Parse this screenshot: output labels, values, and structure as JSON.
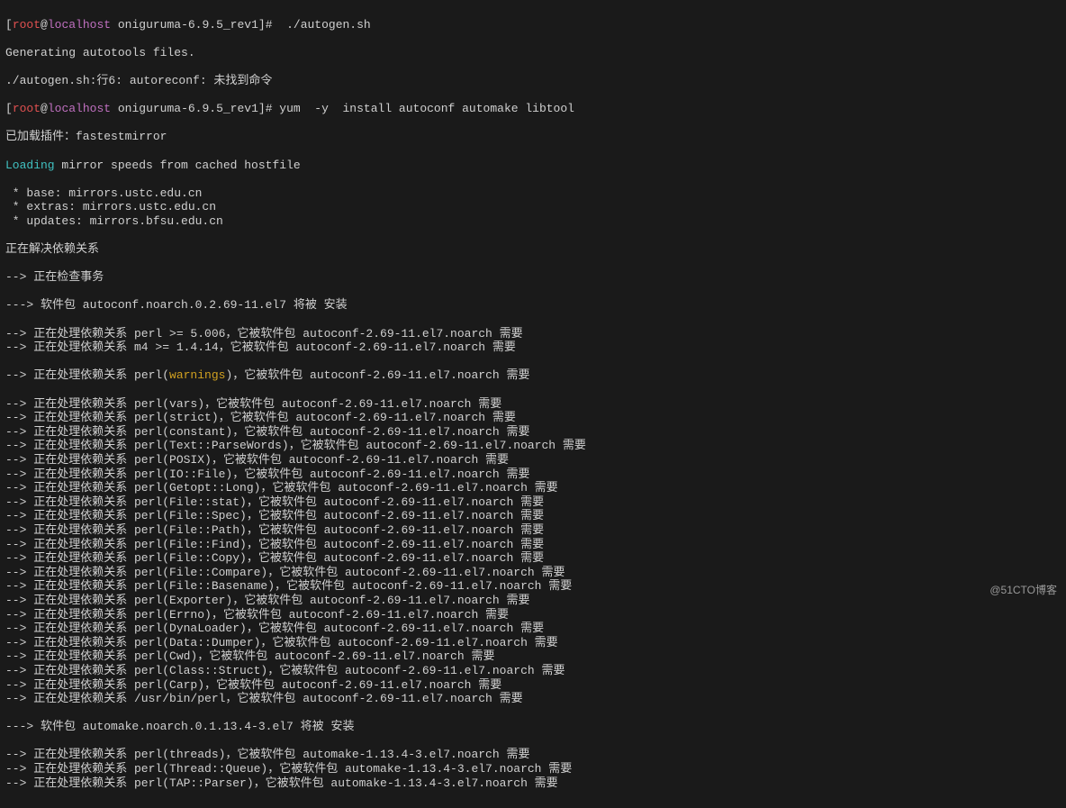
{
  "prompt": {
    "user": "root",
    "at": "@",
    "host": "localhost",
    "path": " oniguruma-6.9.5_rev1",
    "close": "]# "
  },
  "cmd1": " ./autogen.sh",
  "gen": "Generating autotools files.",
  "autogen_err": "./autogen.sh:行6: autoreconf: 未找到命令",
  "cmd2": "yum  -y  install autoconf automake libtool",
  "plugin": "已加载插件：fastestmirror",
  "loading": "Loading",
  "loading_rest": " mirror speeds from cached hostfile",
  "mirrors": [
    " * base: mirrors.ustc.edu.cn",
    " * extras: mirrors.ustc.edu.cn",
    " * updates: mirrors.bfsu.edu.cn"
  ],
  "resolving": "正在解决依赖关系",
  "checking": "--> 正在检查事务",
  "pkg_autoconf": "---> 软件包 autoconf.noarch.0.2.69-11.el7 将被 安装",
  "dep_prefix": "--> 正在处理依赖关系 ",
  "warn_pre": "perl(",
  "warn_word": "warnings",
  "warn_post": ")，它被软件包 autoconf-2.69-11.el7.noarch 需要",
  "deps_autoconf_pre": [
    "perl >= 5.006，它被软件包 autoconf-2.69-11.el7.noarch 需要",
    "m4 >= 1.4.14，它被软件包 autoconf-2.69-11.el7.noarch 需要"
  ],
  "deps_autoconf_post": [
    "perl(vars)，它被软件包 autoconf-2.69-11.el7.noarch 需要",
    "perl(strict)，它被软件包 autoconf-2.69-11.el7.noarch 需要",
    "perl(constant)，它被软件包 autoconf-2.69-11.el7.noarch 需要",
    "perl(Text::ParseWords)，它被软件包 autoconf-2.69-11.el7.noarch 需要",
    "perl(POSIX)，它被软件包 autoconf-2.69-11.el7.noarch 需要",
    "perl(IO::File)，它被软件包 autoconf-2.69-11.el7.noarch 需要",
    "perl(Getopt::Long)，它被软件包 autoconf-2.69-11.el7.noarch 需要",
    "perl(File::stat)，它被软件包 autoconf-2.69-11.el7.noarch 需要",
    "perl(File::Spec)，它被软件包 autoconf-2.69-11.el7.noarch 需要",
    "perl(File::Path)，它被软件包 autoconf-2.69-11.el7.noarch 需要",
    "perl(File::Find)，它被软件包 autoconf-2.69-11.el7.noarch 需要",
    "perl(File::Copy)，它被软件包 autoconf-2.69-11.el7.noarch 需要",
    "perl(File::Compare)，它被软件包 autoconf-2.69-11.el7.noarch 需要",
    "perl(File::Basename)，它被软件包 autoconf-2.69-11.el7.noarch 需要",
    "perl(Exporter)，它被软件包 autoconf-2.69-11.el7.noarch 需要",
    "perl(Errno)，它被软件包 autoconf-2.69-11.el7.noarch 需要",
    "perl(DynaLoader)，它被软件包 autoconf-2.69-11.el7.noarch 需要",
    "perl(Data::Dumper)，它被软件包 autoconf-2.69-11.el7.noarch 需要",
    "perl(Cwd)，它被软件包 autoconf-2.69-11.el7.noarch 需要",
    "perl(Class::Struct)，它被软件包 autoconf-2.69-11.el7.noarch 需要",
    "perl(Carp)，它被软件包 autoconf-2.69-11.el7.noarch 需要",
    "/usr/bin/perl，它被软件包 autoconf-2.69-11.el7.noarch 需要"
  ],
  "pkg_automake": "---> 软件包 automake.noarch.0.1.13.4-3.el7 将被 安装",
  "deps_automake": [
    "perl(threads)，它被软件包 automake-1.13.4-3.el7.noarch 需要",
    "perl(Thread::Queue)，它被软件包 automake-1.13.4-3.el7.noarch 需要",
    "perl(TAP::Parser)，它被软件包 automake-1.13.4-3.el7.noarch 需要"
  ],
  "watermark": "@51CTO博客"
}
